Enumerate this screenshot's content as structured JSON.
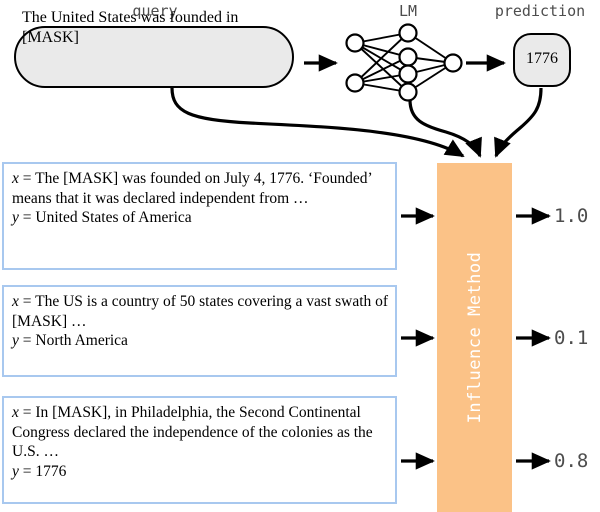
{
  "headers": {
    "query": "query",
    "lm": "LM",
    "prediction": "prediction"
  },
  "query": {
    "text": "The United States was founded in [MASK]"
  },
  "prediction": {
    "value": "1776"
  },
  "lm": {
    "layers": [
      2,
      4,
      1
    ],
    "name": "neural-network"
  },
  "influence": {
    "label": "Influence Method",
    "bar_color": "#fbc287"
  },
  "examples": [
    {
      "x_label": "x",
      "equals": " = ",
      "x_text": "The [MASK] was founded on July 4, 1776. ‘Founded’ means that it was declared independent from …",
      "y_label": "y",
      "y_text": "United States of America",
      "score": "1.0"
    },
    {
      "x_label": "x",
      "equals": " = ",
      "x_text": "The US is a country of 50 states covering a vast swath of [MASK] …",
      "y_label": "y",
      "y_text": "North America",
      "score": "0.1"
    },
    {
      "x_label": "x",
      "equals": " = ",
      "x_text": "In [MASK], in Philadelphia, the Second Continental Congress declared the independence of the colonies as the U.S. …",
      "y_label": "y",
      "y_text": "1776",
      "score": "0.8"
    }
  ],
  "colors": {
    "box_border": "#a8c8ef",
    "pill_fill": "#eaeaea",
    "accent_orange": "#fbc287",
    "header_text": "#4d4d4d"
  }
}
